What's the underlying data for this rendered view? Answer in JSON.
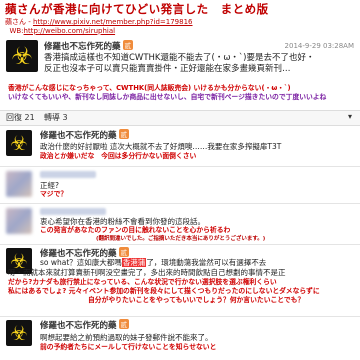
{
  "header": {
    "title": "蘋さんが香港に向けてひどい発言した　まとめ版",
    "src_label": "蘋さん - ",
    "src_url": "http://www.pixiv.net/member.php?id=179816",
    "wb_label": "WB:",
    "wb_url": "http://weibo.com/siruphial"
  },
  "main_post": {
    "username": "修羅也不忘作死的藥",
    "badge": "贰",
    "timestamp": "2014-9-29 03:28AM",
    "text_line1": "香港搞成這樣也不知道CWTHK還能不能去了(・ω・`)要是去不了也好・",
    "text_line2": "反正也沒本子可以賣只能賣賣掛件・正好還能在家多畫幾頁新刊…",
    "ja_line1": "香港がこんな感じになっちゃって、CWTHK(同人誌販売会) いけるかも分からない(・ω・`)",
    "ja_line2": "いけなくてもいいや、新刊なし同誌しか商品に出せないし、自宅で新刊ページ描きたいので丁度いいよね"
  },
  "replybar": {
    "comments": "回復 21",
    "likes": "轉導 3",
    "more": "▾"
  },
  "replies": [
    {
      "username": "修羅也不忘作死的藥",
      "badge": "贰",
      "text": "政治什麼的好討厭啦 這次大概就不去了好煩噢……我要在家多搾擬扉T3T",
      "ja": "政治とか嫌いだな　今回は多分行かない面倒くさい"
    },
    {
      "text1": "正經?",
      "text2": "了廣いい？",
      "ja": "マジで？"
    },
    {
      "text": "衷心希望你在香港的粉絲不會看到你發的這段話。",
      "ja1": "この発言があなたのファンの目に触れないことを心から祈るわ",
      "ja2": "(翻訳間違いでした。ご指摘いただき本当にありがとうございます。)"
    },
    {
      "username": "修羅也不忘作死的藥",
      "badge": "贰",
      "text1": "so what？這如康大都嗎",
      "hl": "香港蒲",
      "text1b": "了，環境動蕩我當然可以有選擇不去",
      "text2": "呀・而就本來就打算賣新刊啊没空畫完了，多出來的時間飲點自己想劃的事情不是正",
      "ja1": "だから?カナダも旅行禁止になっている、こんな状況で行かない選択肢を選ぶ権利くらい",
      "ja2": "私にはあるでしょ? 元々イベント参加の新刊を段々にして描くつもりだったのにしないとダメならずに",
      "ja3": "自分がやりたいことをやってもいいでしょう？何か言いたいことでも？"
    },
    {
      "username": "修羅也不忘作死的藥",
      "badge": "贰",
      "text": "啊想起要給之前預約過取的妹子發郵件說不能來了。",
      "ja": "前の予約者たちにメールして行けないことを知らせないと"
    }
  ]
}
